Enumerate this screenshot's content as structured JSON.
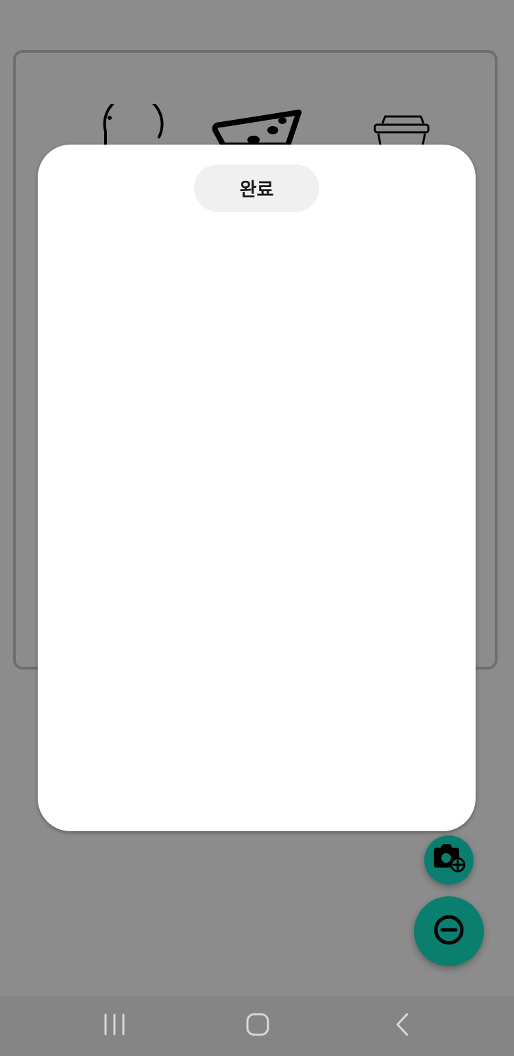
{
  "modal": {
    "done_label": "완료"
  },
  "background": {
    "icons": [
      "speech-bubble-icon",
      "pizza-slice-icon",
      "coffee-cup-icon"
    ]
  },
  "fabs": [
    {
      "name": "camera-add-icon"
    },
    {
      "name": "remove-circle-icon"
    }
  ],
  "navbar": {
    "buttons": [
      "recent-apps-icon",
      "home-icon",
      "back-icon"
    ]
  },
  "colors": {
    "overlay": "#8c8c8c",
    "accent": "#0a7f70",
    "modal": "#ffffff",
    "button_bg": "#f0f0f0",
    "navbar": "#858585"
  }
}
